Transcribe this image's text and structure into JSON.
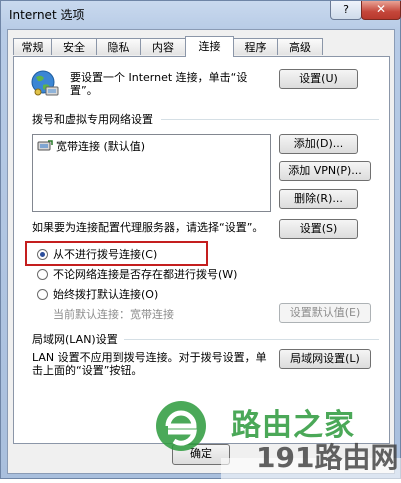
{
  "window": {
    "title": "Internet 选项",
    "help_label": "?",
    "close_label": "✕"
  },
  "tabs": [
    "常规",
    "安全",
    "隐私",
    "内容",
    "连接",
    "程序",
    "高级"
  ],
  "active_tab": "连接",
  "setup": {
    "text": "要设置一个 Internet 连接，单击“设置”。",
    "button": "设置(U)"
  },
  "dialup": {
    "heading": "拨号和虚拟专用网络设置",
    "items": [
      {
        "label": "宽带连接 (默认值)"
      }
    ],
    "add_button": "添加(D)...",
    "add_vpn_button": "添加 VPN(P)...",
    "delete_button": "删除(R)...",
    "proxy_text": "如果要为连接配置代理服务器，请选择“设置”。",
    "settings_button": "设置(S)",
    "options": [
      {
        "label": "从不进行拨号连接(C)",
        "selected": true
      },
      {
        "label": "不论网络连接是否存在都进行拨号(W)",
        "selected": false
      },
      {
        "label": "始终拨打默认连接(O)",
        "selected": false
      }
    ],
    "current_default_label": "当前默认连接：",
    "current_default_value": "宽带连接",
    "set_default_button": "设置默认值(E)"
  },
  "lan": {
    "heading": "局域网(LAN)设置",
    "text": "LAN 设置不应用到拨号连接。对于拨号设置，单击上面的“设置”按钮。",
    "button": "局域网设置(L)"
  },
  "footer": {
    "ok_button": "确定"
  },
  "watermark": {
    "site_name": "路由之家",
    "logo_text": "191路由网",
    "brand_color": "#2c9a3c"
  }
}
